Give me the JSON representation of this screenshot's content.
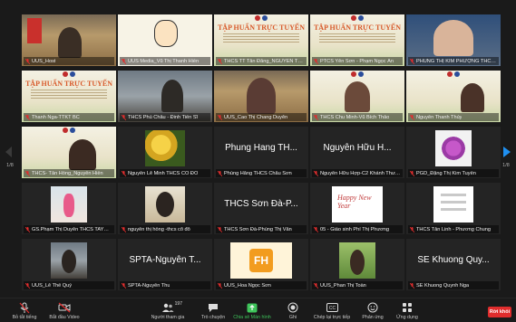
{
  "tiles": [
    {
      "label": "UUS_Host",
      "center": ""
    },
    {
      "label": "UUS Media_Vũ Thị Thanh Hiền",
      "center": ""
    },
    {
      "label": "THCS TT Tân Đăng_NGUYỄN THỊ P...",
      "center": ""
    },
    {
      "label": "PTCS Yên Sơn - Phạm Ngọc Ân",
      "center": ""
    },
    {
      "label": "PHUNG THỊ KIM PHƯỢNG THCS T...",
      "center": ""
    },
    {
      "label": "Thanh Nga-TTKT BC",
      "center": ""
    },
    {
      "label": "THCS Phú Châu - Đinh Tiến Sĩ",
      "center": ""
    },
    {
      "label": "UUS_Cao Thị Chang Duyên",
      "center": ""
    },
    {
      "label": "THCS Chu Minh-Vũ Bích Thảo",
      "center": ""
    },
    {
      "label": "Nguyễn Thanh Thủy",
      "center": ""
    },
    {
      "label": "THCS- Tân Hồng_Nguyễn Hiền",
      "center": ""
    },
    {
      "label": "Nguyễn Lê Minh THCS CỔ ĐÔ",
      "center": ""
    },
    {
      "label": "Phùng Hằng THCS Châu Sơn",
      "center": "Phung Hang TH..."
    },
    {
      "label": "Nguyễn Hữu Hợp-C2 Khánh Thượ...",
      "center": "Nguyễn Hữu H..."
    },
    {
      "label": "PGD_Đặng Thị Kim Tuyến",
      "center": ""
    },
    {
      "label": "GS.Phạm Thị Duyên THCS TAYDA...",
      "center": ""
    },
    {
      "label": "nguyễn thị hồng -thcs cổ đô",
      "center": ""
    },
    {
      "label": "THCS Sơn Đà-Phùng Thị Vân",
      "center": "THCS Sơn Đà-P..."
    },
    {
      "label": "05 - Giáo sinh Phí Thị Phương",
      "center": ""
    },
    {
      "label": "THCS Tân Linh - Phương Chung",
      "center": ""
    },
    {
      "label": "UUS_Lê Thế Quý",
      "center": ""
    },
    {
      "label": "SPTA-Nguyễn Thu",
      "center": "SPTA-Nguyễn T..."
    },
    {
      "label": "UUS_Hoa Ngọc Sơn",
      "center": ""
    },
    {
      "label": "UUS_Phan Thị Toàn",
      "center": ""
    },
    {
      "label": "SE Khuong Quynh Nga",
      "center": "SE Khuong Quy..."
    }
  ],
  "banner_title": "TẬP HUẤN TRỰC TUYẾN",
  "newyear_text": "Happy New Year",
  "fh_text": "FH",
  "pager": {
    "left": "1/8",
    "right": "1/8"
  },
  "toolbar": {
    "unmute": "Bỏ tắt tiếng",
    "start_video": "Bắt đầu Video",
    "participants": "Người tham gia",
    "participants_count": "197",
    "chat": "Trò chuyện",
    "share": "Chia sẻ Màn hình",
    "record": "Ghi",
    "captions": "Chép lại trực tiếp",
    "reactions": "Phản ứng",
    "apps": "Ứng dụng",
    "leave": "Rời khỏi"
  },
  "colors": {
    "active_border": "#c7d23c",
    "share_green": "#3ec45a",
    "leave_red": "#e02d2d",
    "arrow_blue": "#1f8ff0"
  }
}
